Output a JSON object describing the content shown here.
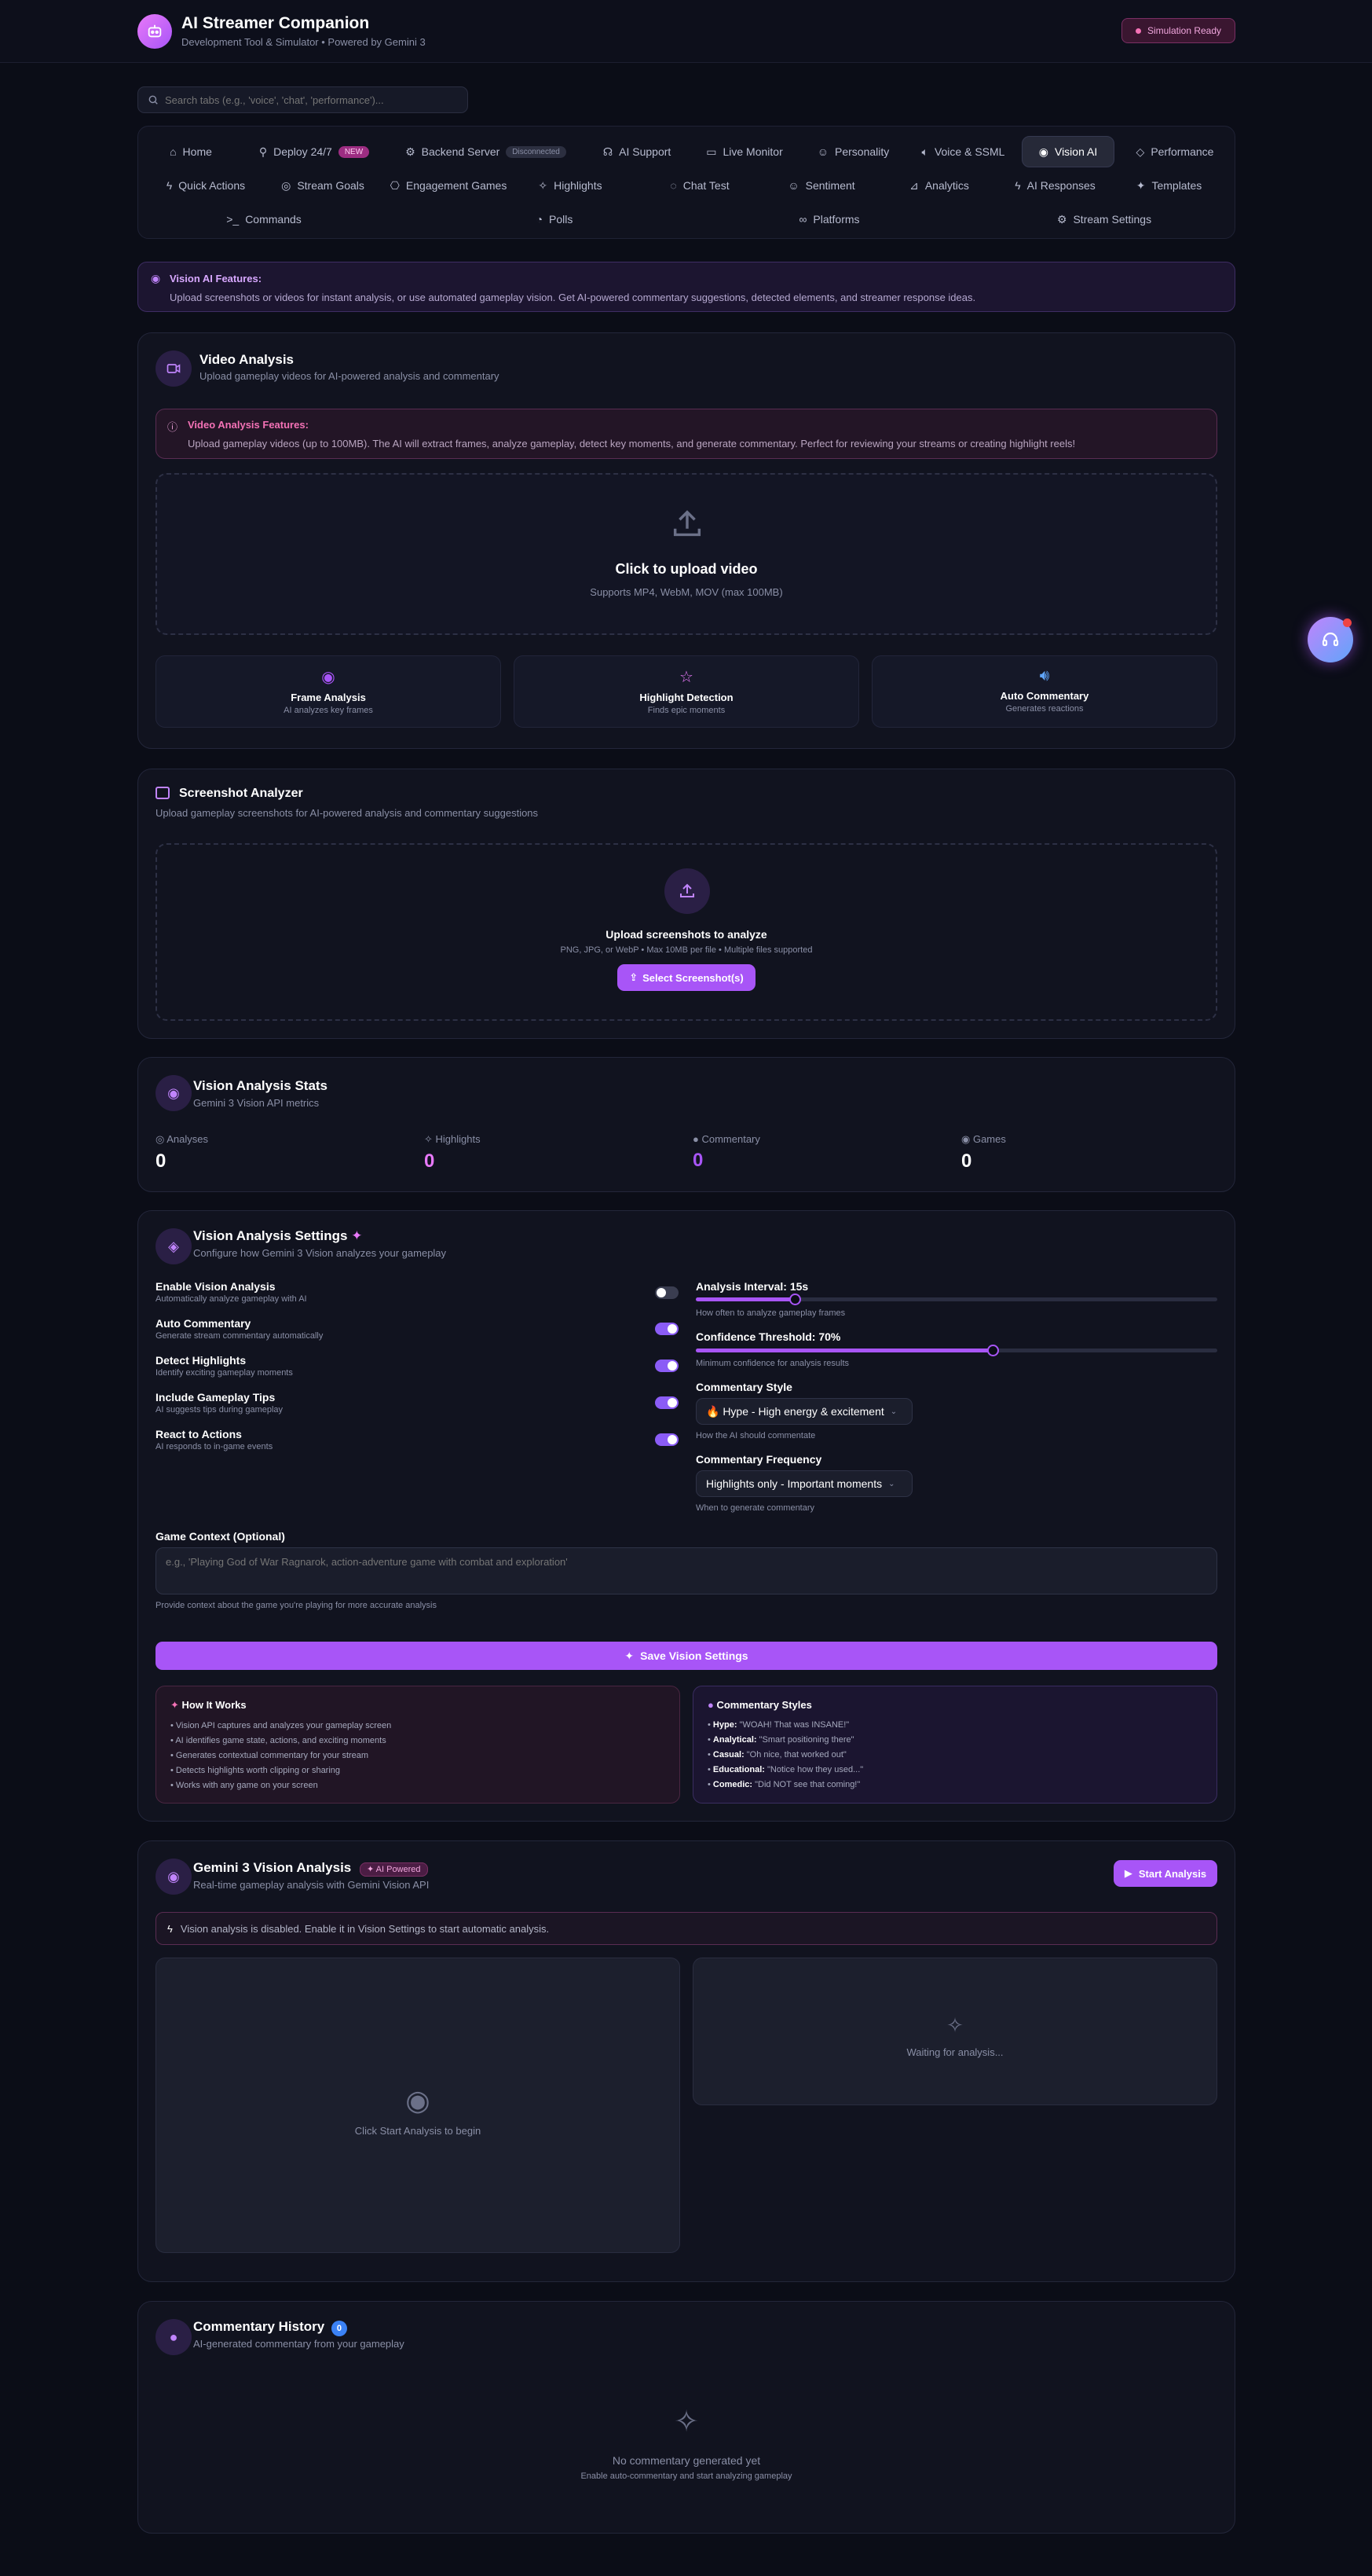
{
  "app": {
    "title": "AI Streamer Companion",
    "subtitle": "Development Tool & Simulator • Powered by Gemini 3",
    "status": "Simulation Ready"
  },
  "search": {
    "placeholder": "Search tabs (e.g., 'voice', 'chat', 'performance')..."
  },
  "tabs": {
    "home": "Home",
    "deploy": "Deploy 24/7",
    "deploy_badge": "NEW",
    "backend": "Backend Server",
    "backend_badge": "Disconnected",
    "ai_support": "AI Support",
    "live_monitor": "Live Monitor",
    "personality": "Personality",
    "voice": "Voice & SSML",
    "vision": "Vision AI",
    "performance": "Performance",
    "quick_actions": "Quick Actions",
    "stream_goals": "Stream Goals",
    "engagement": "Engagement Games",
    "highlights": "Highlights",
    "chat_test": "Chat Test",
    "sentiment": "Sentiment",
    "analytics": "Analytics",
    "ai_responses": "AI Responses",
    "templates": "Templates",
    "commands": "Commands",
    "polls": "Polls",
    "platforms": "Platforms",
    "stream_settings": "Stream Settings"
  },
  "vision_banner": {
    "title": "Vision AI Features:",
    "text": "Upload screenshots or videos for instant analysis, or use automated gameplay vision. Get AI-powered commentary suggestions, detected elements, and streamer response ideas."
  },
  "video": {
    "title": "Video Analysis",
    "subtitle": "Upload gameplay videos for AI-powered analysis and commentary",
    "features_title": "Video Analysis Features:",
    "features_text": "Upload gameplay videos (up to 100MB). The AI will extract frames, analyze gameplay, detect key moments, and generate commentary. Perfect for reviewing your streams or creating highlight reels!",
    "upload_title": "Click to upload video",
    "upload_sub": "Supports MP4, WebM, MOV (max 100MB)",
    "features": [
      {
        "title": "Frame Analysis",
        "sub": "AI analyzes key frames"
      },
      {
        "title": "Highlight Detection",
        "sub": "Finds epic moments"
      },
      {
        "title": "Auto Commentary",
        "sub": "Generates reactions"
      }
    ]
  },
  "screenshot": {
    "title": "Screenshot Analyzer",
    "subtitle": "Upload gameplay screenshots for AI-powered analysis and commentary suggestions",
    "upload_title": "Upload screenshots to analyze",
    "upload_sub": "PNG, JPG, or WebP • Max 10MB per file • Multiple files supported",
    "button": "Select Screenshot(s)"
  },
  "stats": {
    "title": "Vision Analysis Stats",
    "subtitle": "Gemini 3 Vision API metrics",
    "items": [
      {
        "label": "Analyses",
        "value": "0"
      },
      {
        "label": "Highlights",
        "value": "0"
      },
      {
        "label": "Commentary",
        "value": "0"
      },
      {
        "label": "Games",
        "value": "0"
      }
    ]
  },
  "settings": {
    "title": "Vision Analysis Settings",
    "subtitle": "Configure how Gemini 3 Vision analyzes your gameplay",
    "toggles": [
      {
        "label": "Enable Vision Analysis",
        "desc": "Automatically analyze gameplay with AI"
      },
      {
        "label": "Auto Commentary",
        "desc": "Generate stream commentary automatically"
      },
      {
        "label": "Detect Highlights",
        "desc": "Identify exciting gameplay moments"
      },
      {
        "label": "Include Gameplay Tips",
        "desc": "AI suggests tips during gameplay"
      },
      {
        "label": "React to Actions",
        "desc": "AI responds to in-game events"
      }
    ],
    "interval_label": "Analysis Interval: 15s",
    "interval_desc": "How often to analyze gameplay frames",
    "confidence_label": "Confidence Threshold: 70%",
    "confidence_desc": "Minimum confidence for analysis results",
    "style_label": "Commentary Style",
    "style_value": "🔥 Hype - High energy & excitement",
    "style_desc": "How the AI should commentate",
    "freq_label": "Commentary Frequency",
    "freq_value": "Highlights only - Important moments",
    "freq_desc": "When to generate commentary",
    "context_label": "Game Context (Optional)",
    "context_placeholder": "e.g., 'Playing God of War Ragnarok, action-adventure game with combat and exploration'",
    "context_desc": "Provide context about the game you're playing for more accurate analysis",
    "save": "Save Vision Settings",
    "how_title": "How It Works",
    "how_items": [
      "Vision API captures and analyzes your gameplay screen",
      "AI identifies game state, actions, and exciting moments",
      "Generates contextual commentary for your stream",
      "Detects highlights worth clipping or sharing",
      "Works with any game on your screen"
    ],
    "styles_title": "Commentary Styles",
    "styles_items": [
      {
        "k": "Hype:",
        "v": "\"WOAH! That was INSANE!\""
      },
      {
        "k": "Analytical:",
        "v": "\"Smart positioning there\""
      },
      {
        "k": "Casual:",
        "v": "\"Oh nice, that worked out\""
      },
      {
        "k": "Educational:",
        "v": "\"Notice how they used...\""
      },
      {
        "k": "Comedic:",
        "v": "\"Did NOT see that coming!\""
      }
    ]
  },
  "gemini": {
    "title": "Gemini 3 Vision Analysis",
    "badge": "AI Powered",
    "subtitle": "Real-time gameplay analysis with Gemini Vision API",
    "button": "Start Analysis",
    "notice": "Vision analysis is disabled. Enable it in Vision Settings to start automatic analysis.",
    "left_text": "Click Start Analysis to begin",
    "right_text": "Waiting for analysis..."
  },
  "history": {
    "title": "Commentary History",
    "count": "0",
    "subtitle": "AI-generated commentary from your gameplay",
    "empty": "No commentary generated yet",
    "empty_sub": "Enable auto-commentary and start analyzing gameplay"
  },
  "colors": {
    "accent": "#a855f7",
    "pink": "#e879f9",
    "blue": "#60a5fa"
  }
}
